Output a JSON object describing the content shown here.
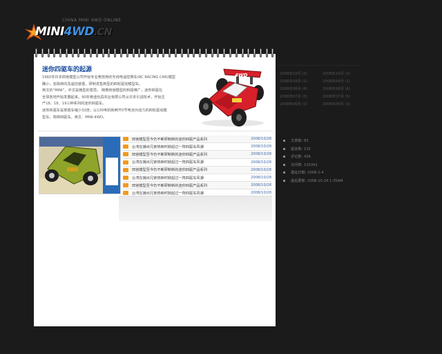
{
  "logo": {
    "subtitle": "CHINA MINI 4WD ONLINE",
    "main_a": "MINI",
    "main_b": "4WD",
    "main_c": ".CN"
  },
  "intro": {
    "title": "迷你四驱车的起源",
    "lines": [
      "1982年日本田宫模型公司开始专业竞技用的无线电遥控赛车(RC RACING CAR)模型",
      "确小，去除转向及遥控装置，研制发售新型的四轮驱动模型车。",
      "英文的“MINI”，中文是微型的意思。 随着田宫模型的积极推广，迷你四驱在",
      "全球各地开始发展起来。90年奥迪玩具实业有限公司从日本引进技术，开始生",
      "产18、18、19三种系列的迷你四驱车。",
      "迷你四驱车是按真车缩小32倍，以130电机和两节5号电池为动力的四轮驱动模",
      "型车，简称四驱车。英文：MINI-4WD。"
    ]
  },
  "news": [
    {
      "title": "田宫模型至今仍不断研制新的迷你四驱产品系列",
      "date": "2008/10/28"
    },
    {
      "title": "台湾在播出兄弟热映时掀起过一阵四驱车风潮",
      "date": "2008/10/28"
    },
    {
      "title": "田宫模型至今仍不断研制新的迷你四驱产品系列",
      "date": "2008/10/28"
    },
    {
      "title": "台湾在播出兄弟热映时掀起过一阵四驱车风潮",
      "date": "2008/10/28"
    },
    {
      "title": "田宫模型至今仍不断研制新的迷你四驱产品系列",
      "date": "2008/10/28"
    },
    {
      "title": "台湾在播出兄弟热映时掀起过一阵四驱车风潮",
      "date": "2008/10/28"
    },
    {
      "title": "田宫模型至今仍不断研制新的迷你四驱产品系列",
      "date": "2008/10/28"
    },
    {
      "title": "台湾在播出兄弟热映时掀起过一阵四驱车风潮",
      "date": "2008/10/28"
    }
  ],
  "archive": [
    "2008年10月 (2)",
    "2008年10月 (2)",
    "2008年09月 (1)",
    "2008年09月 (1)",
    "2008年08月 (6)",
    "2008年08月 (6)",
    "2008年07月 (5)",
    "2008年07月 (5)",
    "2008年06月 (3)",
    "2008年06月 (3)"
  ],
  "stats": [
    "文章数: 83",
    "留言数: 115",
    "评论数: 436",
    "访问数: 110341",
    "建站日期: 2008-1-4",
    "最后更新: 2008-10-24 1:35AM"
  ],
  "colors": {
    "background": "#1b1b1b",
    "title_blue": "#1a4c9e",
    "bullet_orange": "#f29a1c",
    "date_blue": "#3d66a8"
  }
}
